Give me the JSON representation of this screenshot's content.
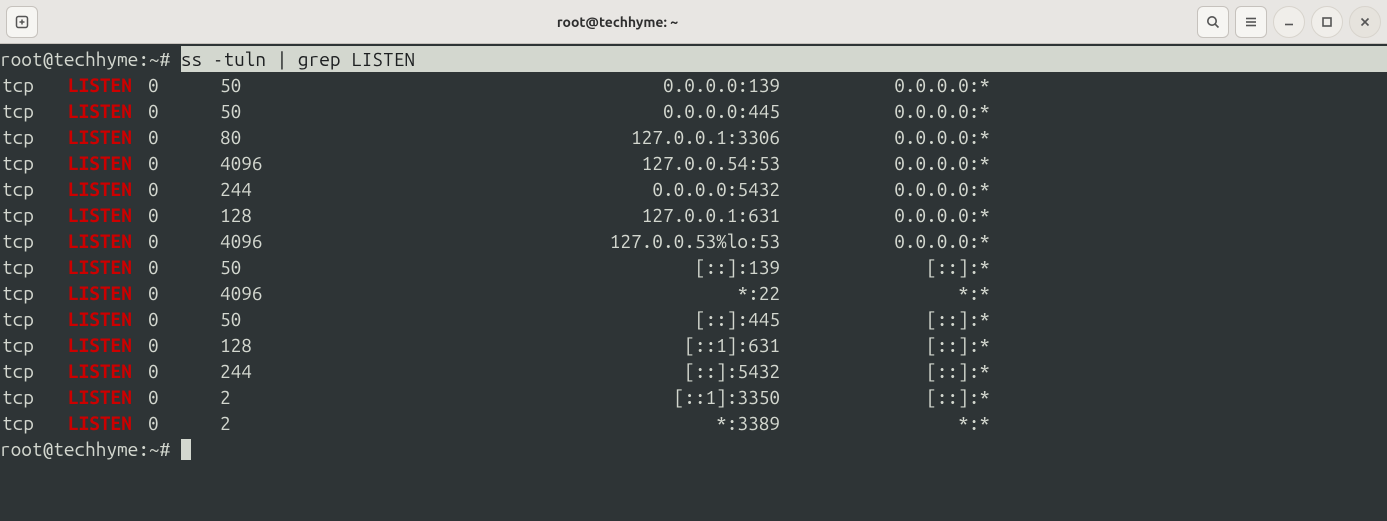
{
  "window": {
    "title": "root@techhyme: ~"
  },
  "prompt": "root@techhyme:~# ",
  "command": "ss -tuln | grep LISTEN",
  "rows": [
    {
      "proto": "tcp",
      "state": "LISTEN",
      "recvq": "0",
      "sendq": "50",
      "local": "0.0.0.0:139",
      "peer": "0.0.0.0:*"
    },
    {
      "proto": "tcp",
      "state": "LISTEN",
      "recvq": "0",
      "sendq": "50",
      "local": "0.0.0.0:445",
      "peer": "0.0.0.0:*"
    },
    {
      "proto": "tcp",
      "state": "LISTEN",
      "recvq": "0",
      "sendq": "80",
      "local": "127.0.0.1:3306",
      "peer": "0.0.0.0:*"
    },
    {
      "proto": "tcp",
      "state": "LISTEN",
      "recvq": "0",
      "sendq": "4096",
      "local": "127.0.0.54:53",
      "peer": "0.0.0.0:*"
    },
    {
      "proto": "tcp",
      "state": "LISTEN",
      "recvq": "0",
      "sendq": "244",
      "local": "0.0.0.0:5432",
      "peer": "0.0.0.0:*"
    },
    {
      "proto": "tcp",
      "state": "LISTEN",
      "recvq": "0",
      "sendq": "128",
      "local": "127.0.0.1:631",
      "peer": "0.0.0.0:*"
    },
    {
      "proto": "tcp",
      "state": "LISTEN",
      "recvq": "0",
      "sendq": "4096",
      "local": "127.0.0.53%lo:53",
      "peer": "0.0.0.0:*"
    },
    {
      "proto": "tcp",
      "state": "LISTEN",
      "recvq": "0",
      "sendq": "50",
      "local": "[::]:139",
      "peer": "[::]:*"
    },
    {
      "proto": "tcp",
      "state": "LISTEN",
      "recvq": "0",
      "sendq": "4096",
      "local": "*:22",
      "peer": "*:*"
    },
    {
      "proto": "tcp",
      "state": "LISTEN",
      "recvq": "0",
      "sendq": "50",
      "local": "[::]:445",
      "peer": "[::]:*"
    },
    {
      "proto": "tcp",
      "state": "LISTEN",
      "recvq": "0",
      "sendq": "128",
      "local": "[::1]:631",
      "peer": "[::]:*"
    },
    {
      "proto": "tcp",
      "state": "LISTEN",
      "recvq": "0",
      "sendq": "244",
      "local": "[::]:5432",
      "peer": "[::]:*"
    },
    {
      "proto": "tcp",
      "state": "LISTEN",
      "recvq": "0",
      "sendq": "2",
      "local": "[::1]:3350",
      "peer": "[::]:*"
    },
    {
      "proto": "tcp",
      "state": "LISTEN",
      "recvq": "0",
      "sendq": "2",
      "local": "*:3389",
      "peer": "*:*"
    }
  ]
}
